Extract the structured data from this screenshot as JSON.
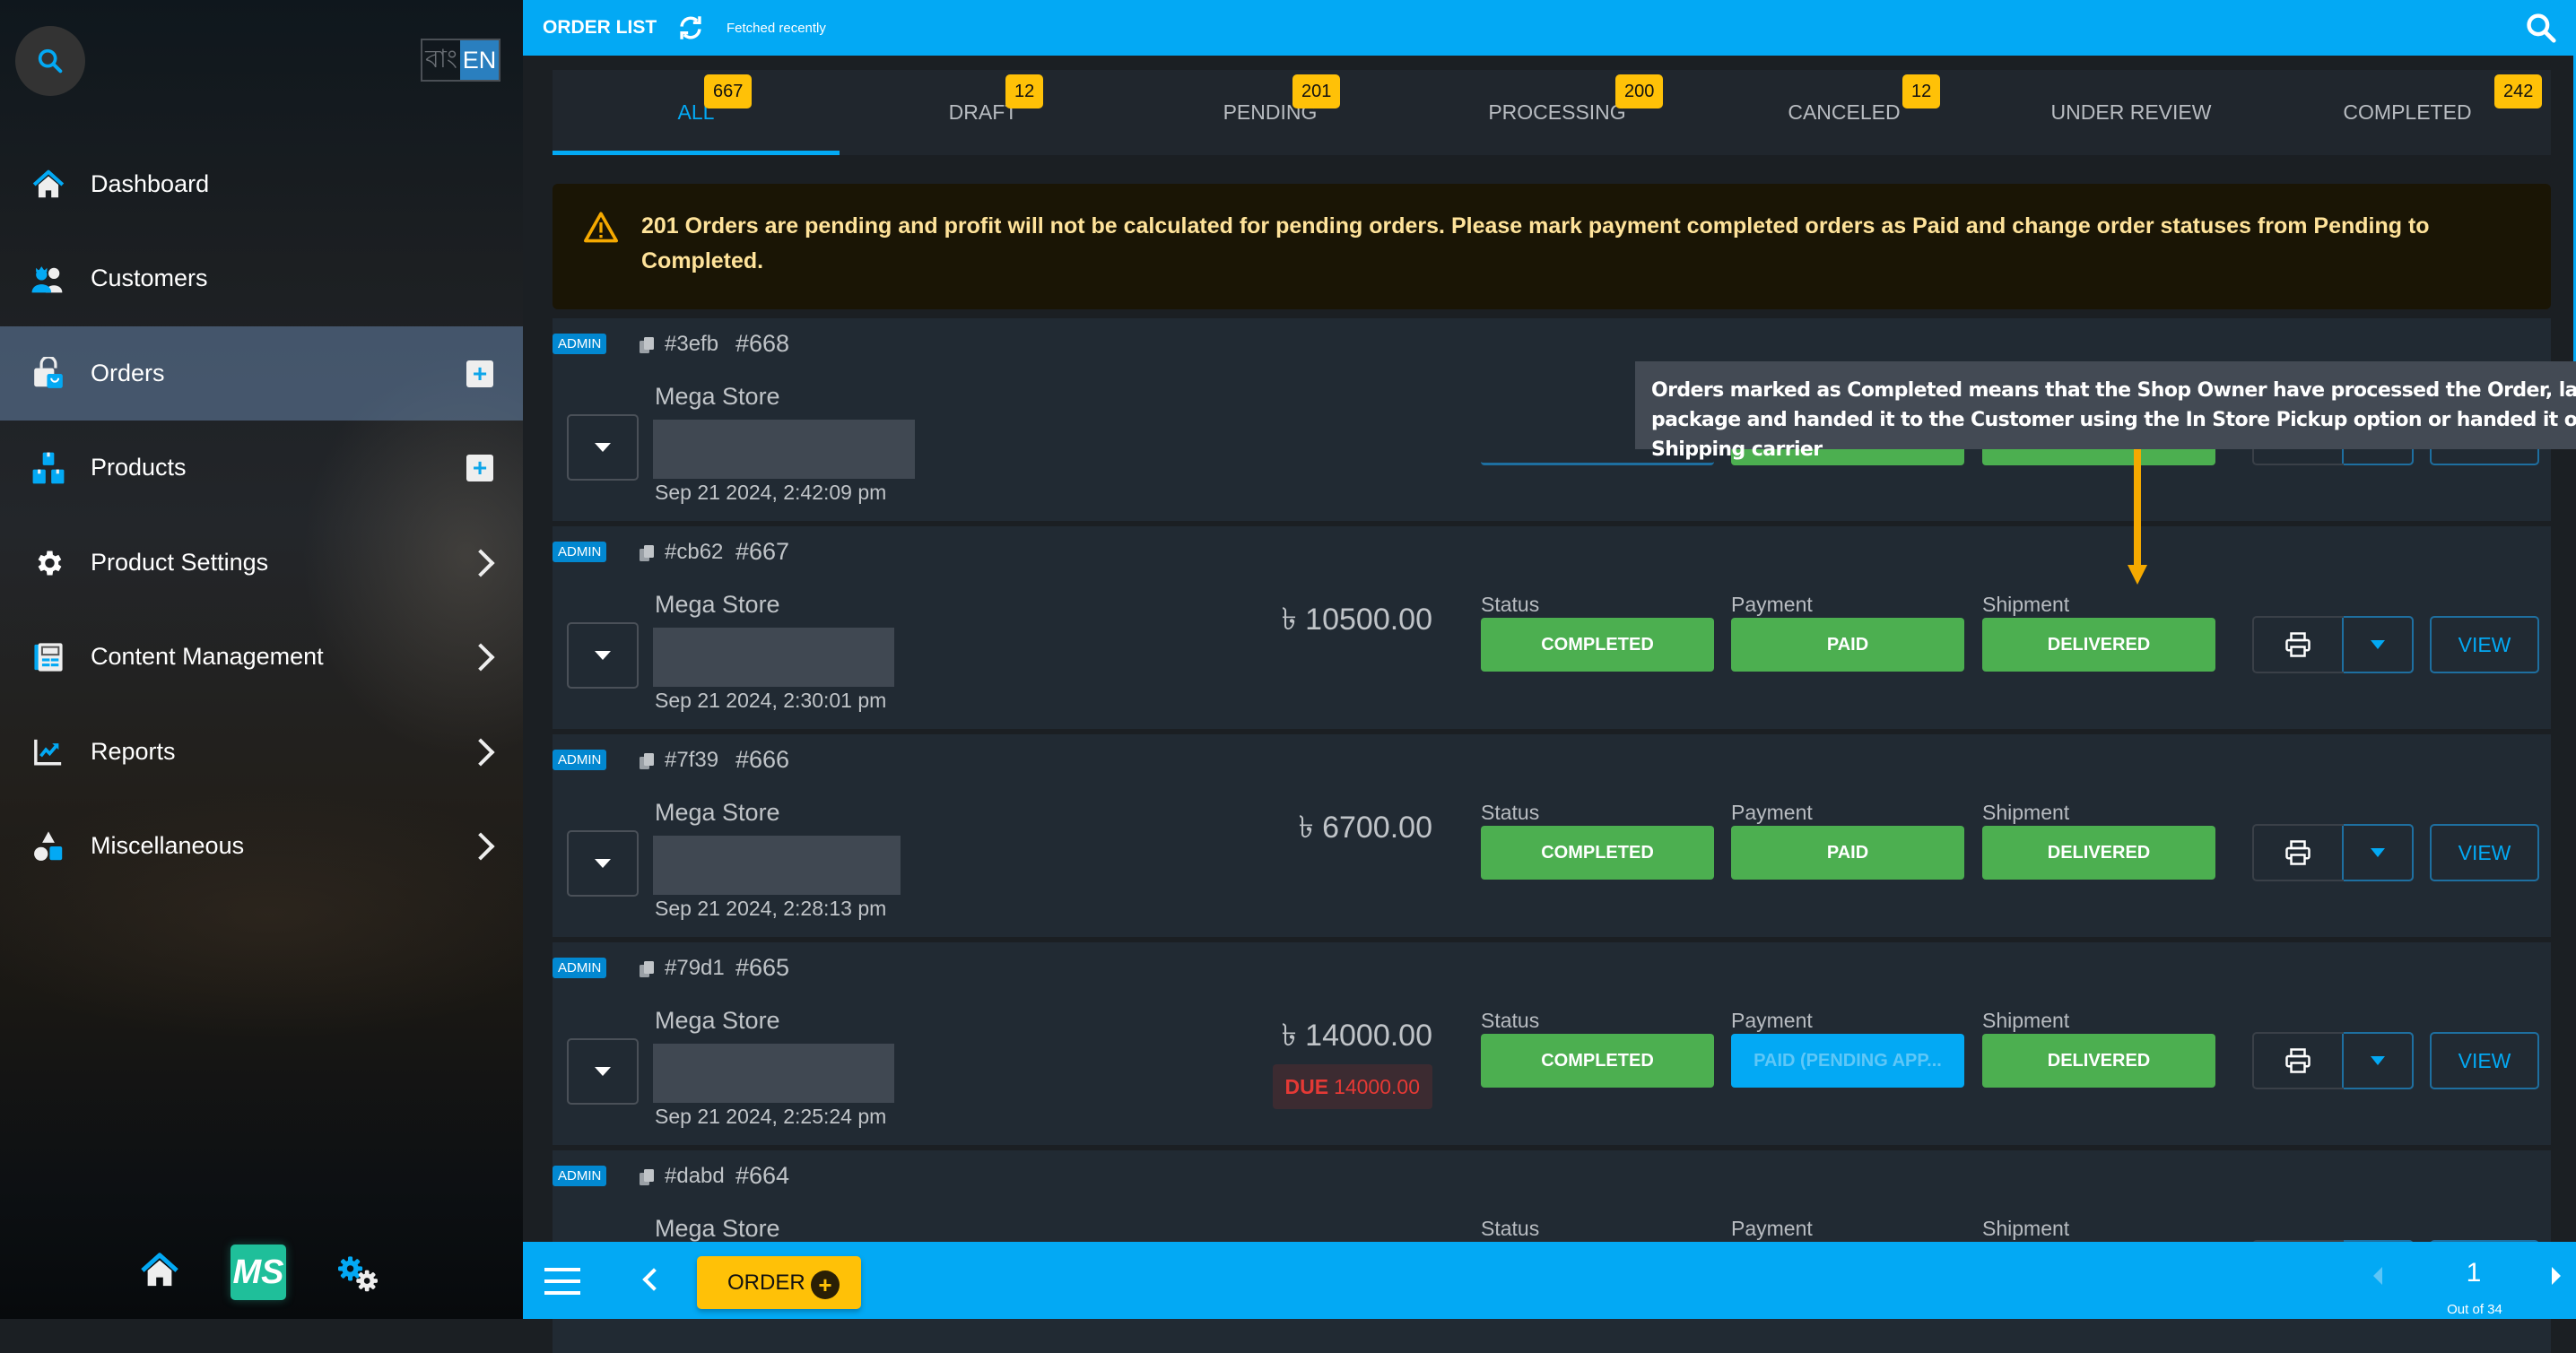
{
  "sidebar": {
    "language": {
      "bn": "বাং",
      "en": "EN",
      "active": "EN"
    },
    "items": [
      {
        "label": "Dashboard",
        "icon": "home-icon",
        "action": "none"
      },
      {
        "label": "Customers",
        "icon": "customers-icon",
        "action": "none"
      },
      {
        "label": "Orders",
        "icon": "orders-bag-icon",
        "action": "plus",
        "active": true
      },
      {
        "label": "Products",
        "icon": "products-boxes-icon",
        "action": "plus"
      },
      {
        "label": "Product Settings",
        "icon": "gear-icon",
        "action": "chevron"
      },
      {
        "label": "Content Management",
        "icon": "content-icon",
        "action": "chevron"
      },
      {
        "label": "Reports",
        "icon": "reports-chart-icon",
        "action": "chevron"
      },
      {
        "label": "Miscellaneous",
        "icon": "shapes-icon",
        "action": "chevron"
      }
    ],
    "bottom": {
      "logo_text": "MS"
    }
  },
  "topbar": {
    "title": "ORDER LIST",
    "fetched": "Fetched recently"
  },
  "tabs": [
    {
      "label": "ALL",
      "count": "667",
      "active": true
    },
    {
      "label": "DRAFT",
      "count": "12"
    },
    {
      "label": "PENDING",
      "count": "201"
    },
    {
      "label": "PROCESSING",
      "count": "200"
    },
    {
      "label": "CANCELED",
      "count": "12"
    },
    {
      "label": "UNDER REVIEW",
      "count": ""
    },
    {
      "label": "COMPLETED",
      "count": "242"
    }
  ],
  "alert": {
    "count": "201",
    "message": "Orders are pending and profit will not be calculated for pending orders. Please mark payment completed orders as Paid and change order statuses from Pending to Completed."
  },
  "field_labels": {
    "status": "Status",
    "payment": "Payment",
    "shipment": "Shipment",
    "view": "VIEW",
    "admin": "ADMIN",
    "due": "DUE"
  },
  "orders": [
    {
      "hash": "#3efb",
      "number": "#668",
      "store": "Mega Store",
      "date": "Sep 21 2024, 2:42:09 pm",
      "amount": "",
      "due": "",
      "status": "",
      "payment": "",
      "shipment": ""
    },
    {
      "hash": "#cb62",
      "number": "#667",
      "store": "Mega Store",
      "date": "Sep 21 2024, 2:30:01 pm",
      "amount": "৳ 10500.00",
      "due": "",
      "status": "COMPLETED",
      "payment": "PAID",
      "shipment": "DELIVERED"
    },
    {
      "hash": "#7f39",
      "number": "#666",
      "store": "Mega Store",
      "date": "Sep 21 2024, 2:28:13 pm",
      "amount": "৳ 6700.00",
      "due": "",
      "status": "COMPLETED",
      "payment": "PAID",
      "shipment": "DELIVERED"
    },
    {
      "hash": "#79d1",
      "number": "#665",
      "store": "Mega Store",
      "date": "Sep 21 2024, 2:25:24 pm",
      "amount": "৳ 14000.00",
      "due": "14000.00",
      "status": "COMPLETED",
      "payment": "PAID (PENDING APP...",
      "shipment": "DELIVERED"
    },
    {
      "hash": "#dabd",
      "number": "#664",
      "store": "Mega Store",
      "date": "",
      "amount": "",
      "due": "",
      "status": "",
      "payment": "",
      "shipment": ""
    }
  ],
  "tooltip": {
    "text": "Orders marked as Completed means that the Shop Owner have processed the Order, labeled the package and handed it to the Customer using the In Store Pickup option or handed it over to the Shipping carrier"
  },
  "bottombar": {
    "order_button": "ORDER",
    "page": "1",
    "page_total": "Out of 34"
  },
  "colors": {
    "accent": "#03a9f4",
    "badge": "#ffc107",
    "success": "#4caf50",
    "danger": "#e53935",
    "annotation": "#f5a900"
  }
}
